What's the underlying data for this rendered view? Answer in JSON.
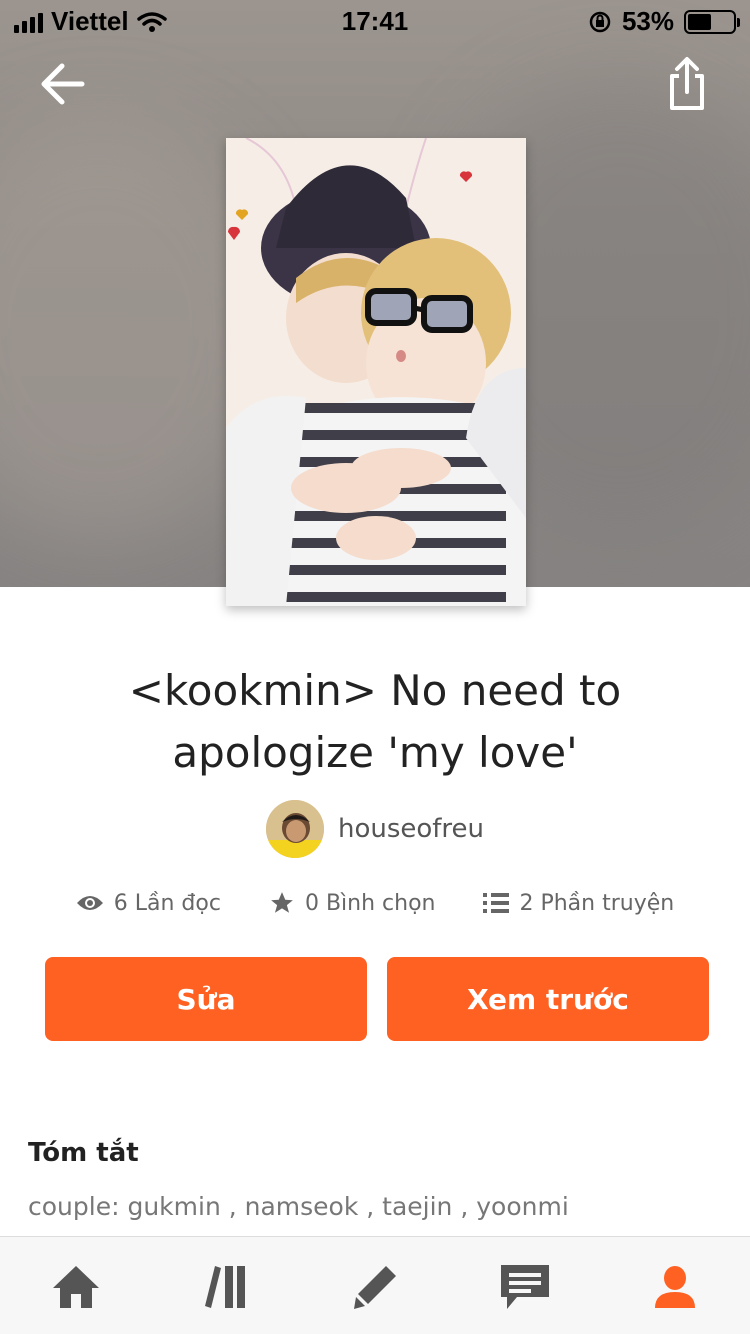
{
  "status_bar": {
    "carrier": "Viettel",
    "time": "17:41",
    "battery": "53%",
    "battery_level": 0.53
  },
  "header": {
    "back_icon": "arrow-left-icon",
    "share_icon": "share-icon"
  },
  "story": {
    "title_line1": "<kookmin> No need to",
    "title_line2": "apologize 'my love'",
    "author": "houseofreu"
  },
  "stats": {
    "reads": "6 Lần đọc",
    "votes": "0 Bình chọn",
    "parts": "2 Phần truyện"
  },
  "actions": {
    "edit_label": "Sửa",
    "preview_label": "Xem trước"
  },
  "summary": {
    "heading": "Tóm tắt",
    "text": "couple: gukmin , namseok , taejin , yoonmi"
  },
  "tabbar": {
    "items": [
      "home-icon",
      "library-icon",
      "write-icon",
      "messages-icon",
      "profile-icon"
    ],
    "active_color": "#ff6122",
    "inactive_color": "#555555"
  },
  "colors": {
    "accent": "#ff6122"
  }
}
